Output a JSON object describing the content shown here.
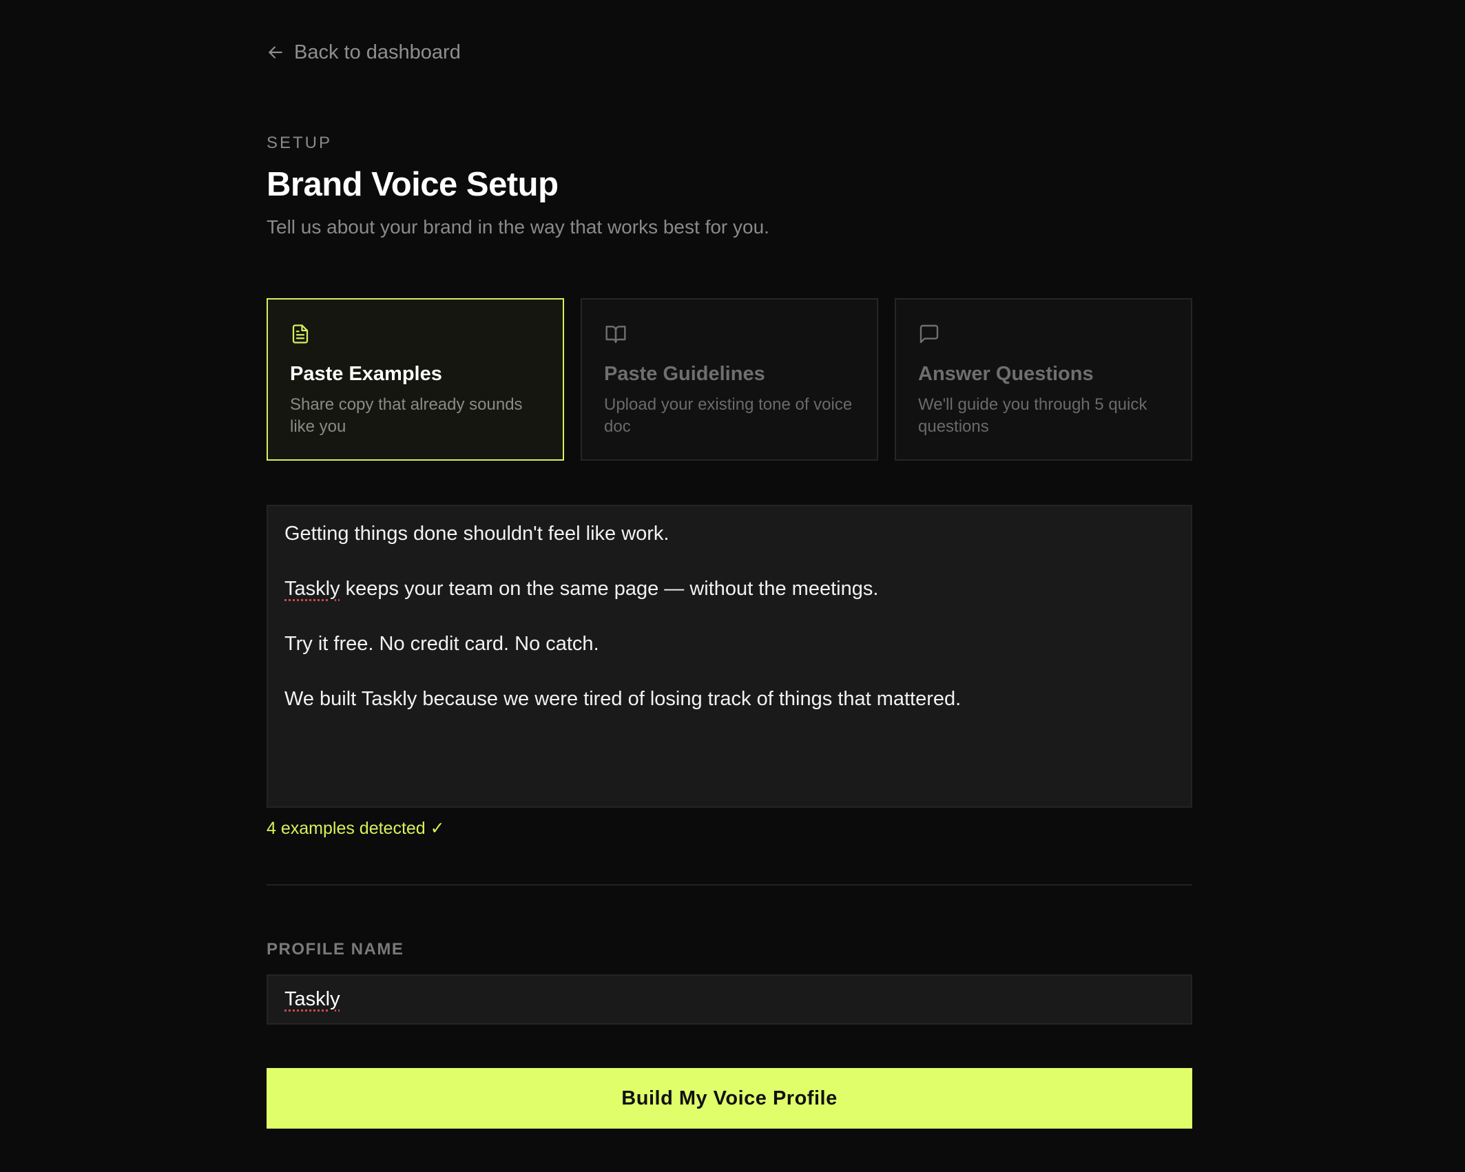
{
  "nav": {
    "back_label": "Back to dashboard",
    "back_icon": "arrow-left-icon"
  },
  "header": {
    "eyebrow": "SETUP",
    "title": "Brand Voice Setup",
    "subtitle": "Tell us about your brand in the way that works best for you."
  },
  "modes": [
    {
      "icon": "document-icon",
      "title": "Paste Examples",
      "description": "Share copy that already sounds like you",
      "selected": true
    },
    {
      "icon": "book-open-icon",
      "title": "Paste Guidelines",
      "description": "Upload your existing tone of voice doc",
      "selected": false
    },
    {
      "icon": "chat-bubble-icon",
      "title": "Answer Questions",
      "description": "We'll guide you through 5 quick questions",
      "selected": false
    }
  ],
  "examples": {
    "lines": [
      "Getting things done shouldn't feel like work.",
      "Taskly keeps your team on the same page — without the meetings.",
      "Try it free. No credit card. No catch.",
      "We built Taskly because we were tired of losing track of things that mattered."
    ],
    "status": "4 examples detected ✓"
  },
  "profile": {
    "label": "PROFILE NAME",
    "value": "Taskly"
  },
  "actions": {
    "build_label": "Build My Voice Profile"
  },
  "colors": {
    "accent": "#e0fe6a",
    "background": "#0b0b0b",
    "surface": "#1a1a1a"
  }
}
